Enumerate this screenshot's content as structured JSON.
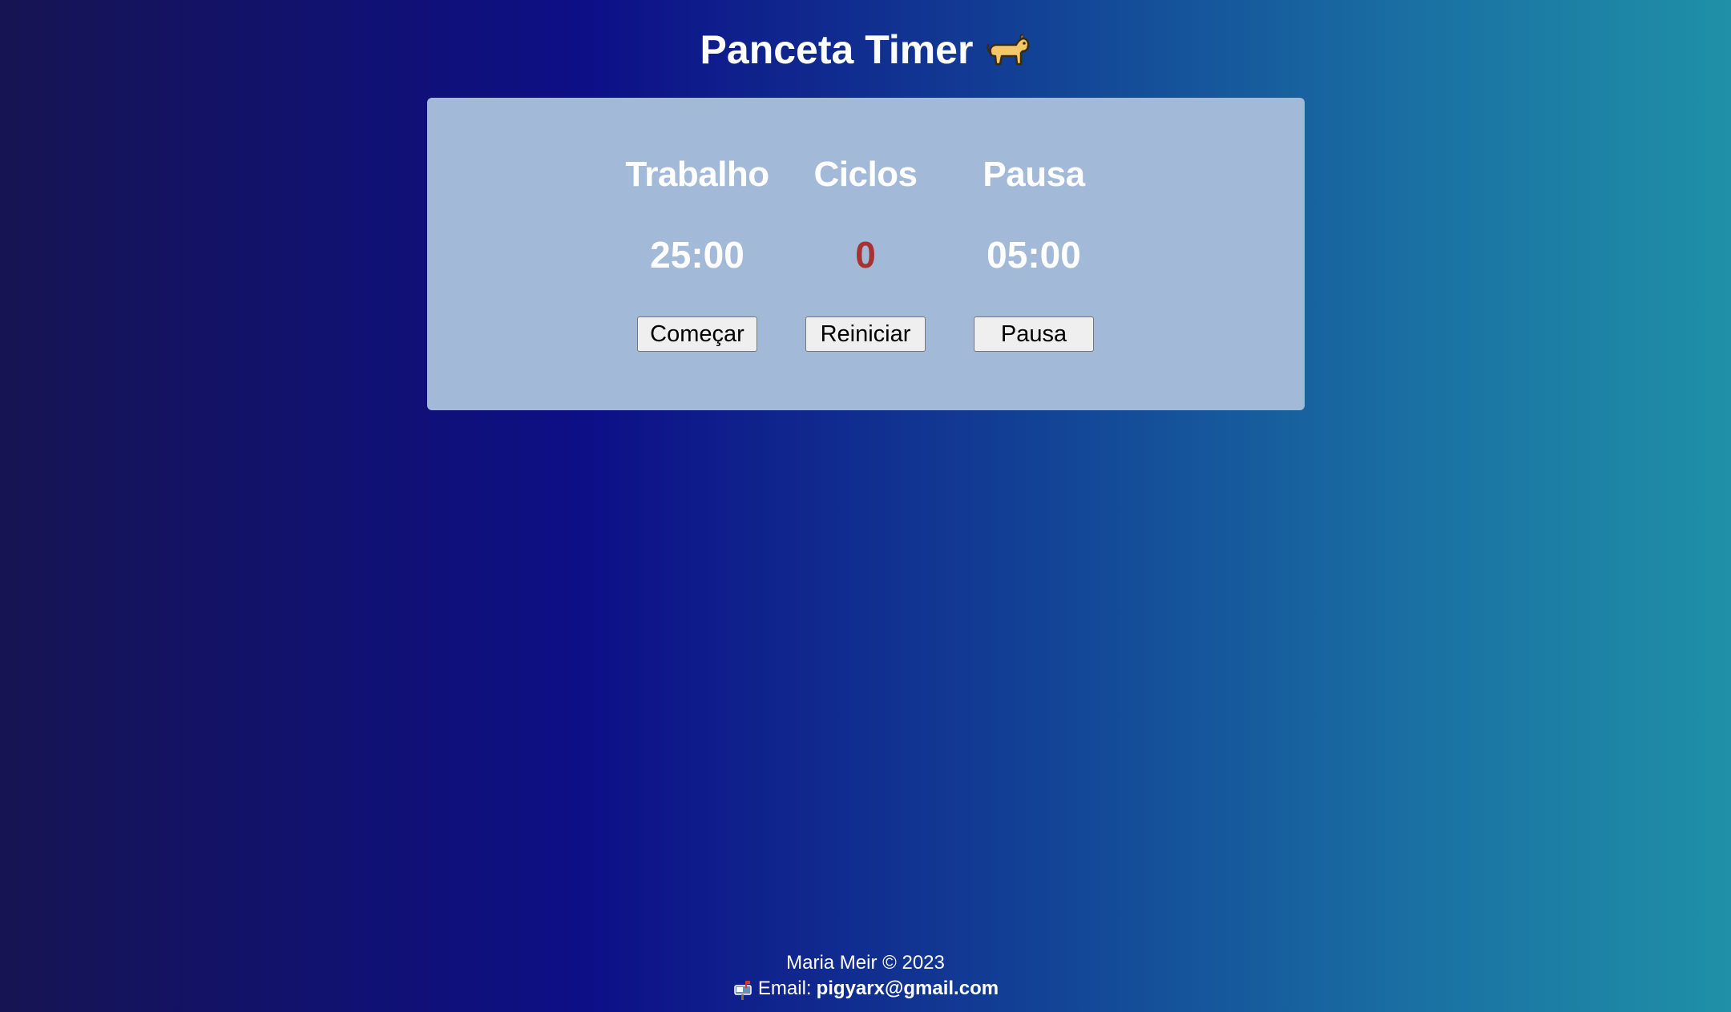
{
  "header": {
    "title": "Panceta Timer",
    "title_icon": "dog-icon"
  },
  "timer": {
    "work": {
      "label": "Trabalho",
      "value": "25:00",
      "button": "Começar"
    },
    "cycles": {
      "label": "Ciclos",
      "value": "0",
      "button": "Reiniciar"
    },
    "break": {
      "label": "Pausa",
      "value": "05:00",
      "button": "Pausa"
    }
  },
  "footer": {
    "copyright": "Maria Meir © 2023",
    "email_icon": "mailbox-icon",
    "email_label": "Email:",
    "email_address": "pigyarx@gmail.com"
  },
  "colors": {
    "card_background": "#a2b9d8",
    "cycles_value": "#a63232",
    "gradient_start": "#161452",
    "gradient_end": "#1f90a7"
  }
}
